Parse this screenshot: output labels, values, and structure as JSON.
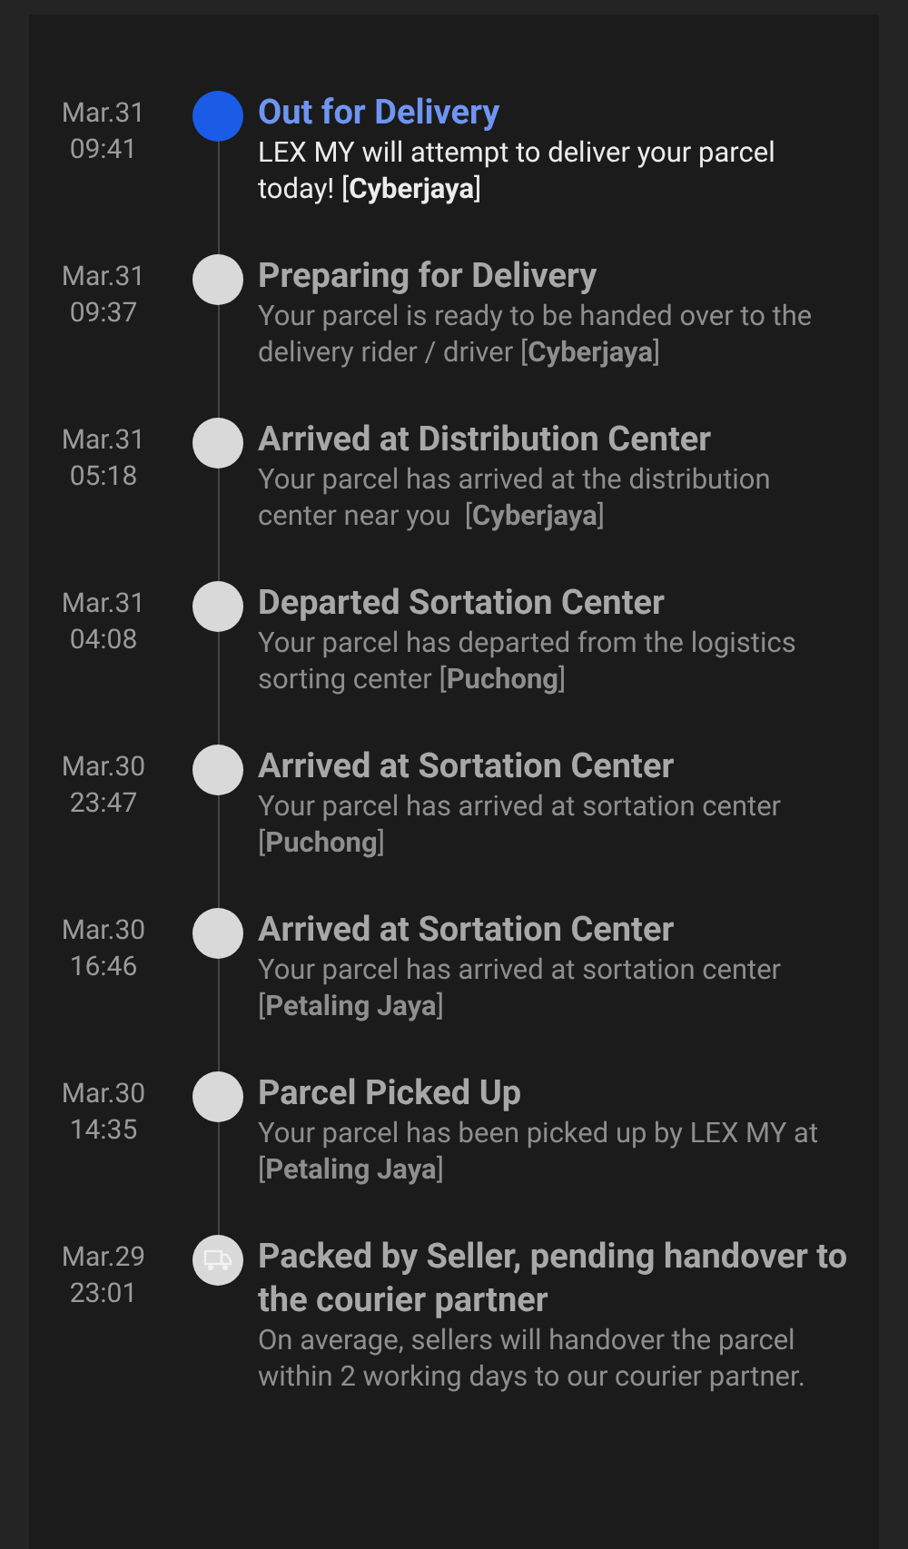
{
  "events": [
    {
      "date": "Mar.31",
      "time": "09:41",
      "title": "Out for Delivery",
      "description": "LEX MY will attempt to deliver your parcel today! [**Cyberjaya**]",
      "current": true,
      "kind": "dot"
    },
    {
      "date": "Mar.31",
      "time": "09:37",
      "title": "Preparing for Delivery",
      "description": "Your parcel is ready to be handed over to the delivery rider / driver [**Cyberjaya**]",
      "current": false,
      "kind": "dot"
    },
    {
      "date": "Mar.31",
      "time": "05:18",
      "title": "Arrived at Distribution Center",
      "description": "Your parcel has arrived at the distribution center near you  [**Cyberjaya**]",
      "current": false,
      "kind": "dot"
    },
    {
      "date": "Mar.31",
      "time": "04:08",
      "title": "Departed Sortation Center",
      "description": "Your parcel has departed from the logistics sorting center [**Puchong**]",
      "current": false,
      "kind": "dot"
    },
    {
      "date": "Mar.30",
      "time": "23:47",
      "title": "Arrived at Sortation Center",
      "description": "Your parcel has arrived at sortation center [**Puchong**]",
      "current": false,
      "kind": "dot"
    },
    {
      "date": "Mar.30",
      "time": "16:46",
      "title": "Arrived at Sortation Center",
      "description": "Your parcel has arrived at sortation center [**Petaling Jaya**]",
      "current": false,
      "kind": "dot"
    },
    {
      "date": "Mar.30",
      "time": "14:35",
      "title": "Parcel Picked Up",
      "description": "Your parcel has been picked up by LEX MY at [**Petaling Jaya**]",
      "current": false,
      "kind": "dot"
    },
    {
      "date": "Mar.29",
      "time": "23:01",
      "title": "Packed by Seller, pending handover to the courier partner",
      "description": "On average, sellers will handover the parcel within 2 working days to our courier partner.",
      "current": false,
      "kind": "truck"
    }
  ]
}
